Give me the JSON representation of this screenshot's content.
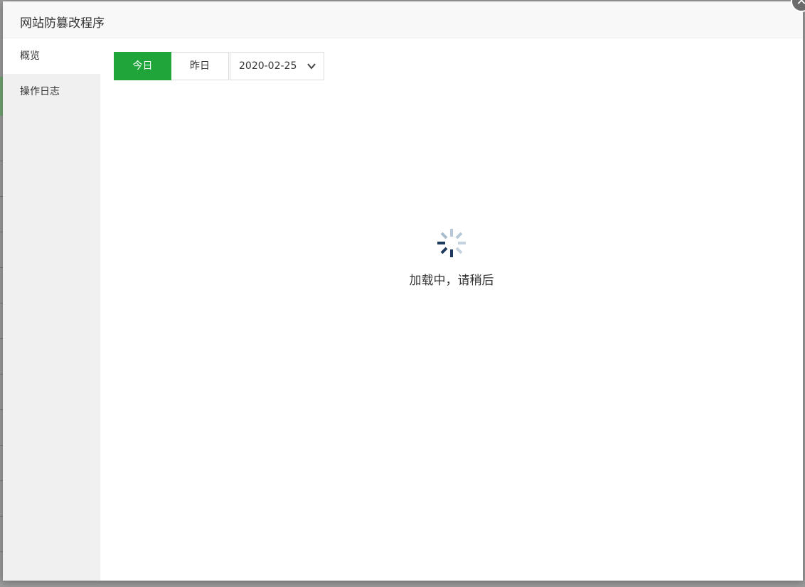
{
  "window": {
    "title": "网站防篡改程序",
    "close_glyph": "✕"
  },
  "sidebar": {
    "items": [
      {
        "label": "概览",
        "active": true
      },
      {
        "label": "操作日志",
        "active": false
      }
    ]
  },
  "toolbar": {
    "tabs": [
      {
        "label": "今日",
        "active": true
      },
      {
        "label": "昨日",
        "active": false
      }
    ],
    "date_value": "2020-02-25"
  },
  "loading": {
    "text": "加载中，请稍后"
  },
  "colors": {
    "accent": "#20a53a",
    "spinner_dark": "#1d3a5c",
    "spinner_light": "#b8c8d8"
  }
}
